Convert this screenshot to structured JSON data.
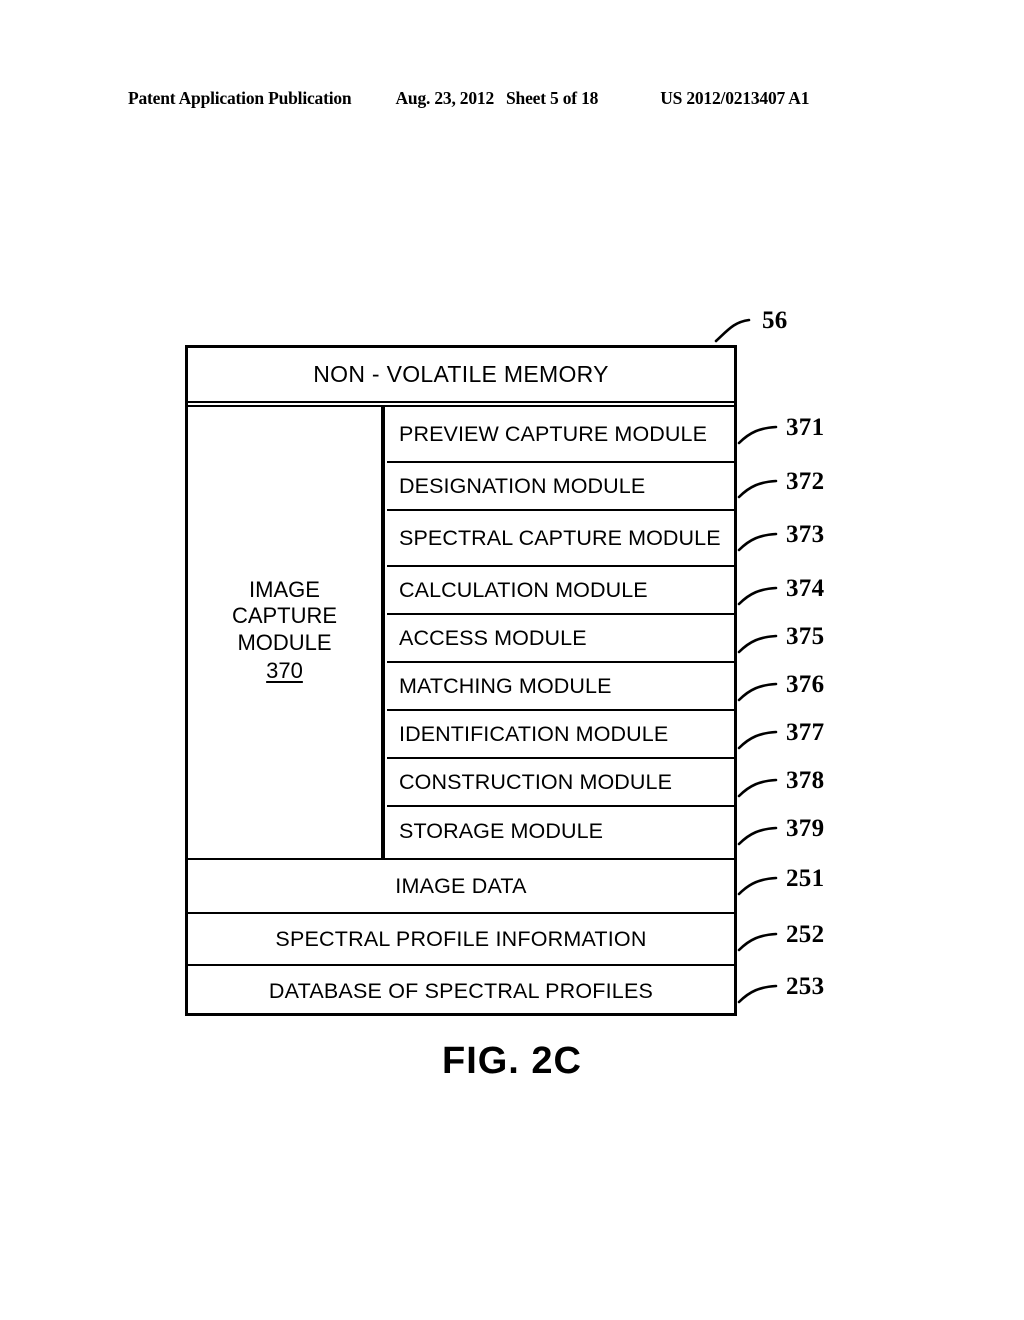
{
  "page_header": {
    "publication": "Patent Application Publication",
    "date": "Aug. 23, 2012",
    "sheet": "Sheet 5 of 18",
    "patent_number": "US 2012/0213407 A1"
  },
  "figure": {
    "caption": "FIG. 2C",
    "memory_title": "NON - VOLATILE MEMORY",
    "memory_ref": "56",
    "image_capture_module": {
      "label_line1": "IMAGE",
      "label_line2": "CAPTURE",
      "label_line3": "MODULE",
      "ref": "370"
    },
    "modules": [
      {
        "label": "PREVIEW CAPTURE MODULE",
        "ref": "371",
        "lines": 2
      },
      {
        "label": "DESIGNATION MODULE",
        "ref": "372",
        "lines": 1
      },
      {
        "label": "SPECTRAL CAPTURE MODULE",
        "ref": "373",
        "lines": 2
      },
      {
        "label": "CALCULATION MODULE",
        "ref": "374",
        "lines": 1
      },
      {
        "label": "ACCESS MODULE",
        "ref": "375",
        "lines": 1
      },
      {
        "label": "MATCHING MODULE",
        "ref": "376",
        "lines": 1
      },
      {
        "label": "IDENTIFICATION MODULE",
        "ref": "377",
        "lines": 1
      },
      {
        "label": "CONSTRUCTION MODULE",
        "ref": "378",
        "lines": 1
      },
      {
        "label": "STORAGE MODULE",
        "ref": "379",
        "lines": 1
      }
    ],
    "data_sections": [
      {
        "label": "IMAGE DATA",
        "ref": "251"
      },
      {
        "label": "SPECTRAL PROFILE INFORMATION",
        "ref": "252"
      },
      {
        "label": "DATABASE OF SPECTRAL PROFILES",
        "ref": "253"
      }
    ]
  },
  "colors": {
    "ink": "#000000",
    "paper": "#ffffff"
  }
}
